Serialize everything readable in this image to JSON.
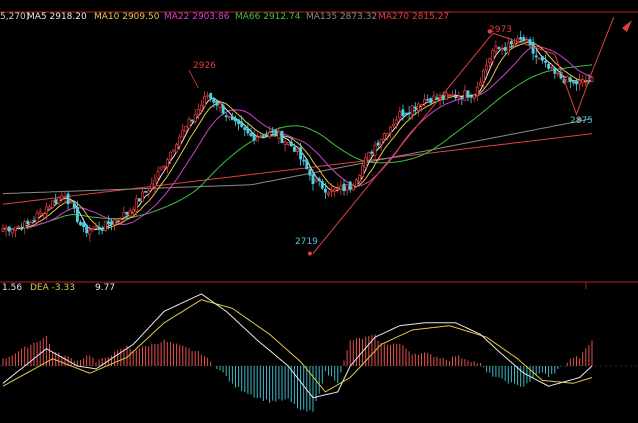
{
  "chart_data": [
    {
      "type": "candlestick",
      "panel": "price",
      "legend": [
        {
          "key": "params",
          "text": "5,270)",
          "color": "#cfcfcf"
        },
        {
          "key": "ma5",
          "text": "MA5 2918.20",
          "color": "#e8e8e8"
        },
        {
          "key": "ma10",
          "text": "MA10 2909.50",
          "color": "#e0c84a"
        },
        {
          "key": "ma22",
          "text": "MA22 2903.86",
          "color": "#d040d0"
        },
        {
          "key": "ma66",
          "text": "MA66 2912.74",
          "color": "#40c040"
        },
        {
          "key": "ma135",
          "text": "MA135 2873.32",
          "color": "#8a8a8a"
        },
        {
          "key": "ma270",
          "text": "MA270 2815.27",
          "color": "#e04040"
        }
      ],
      "annotations": [
        {
          "text": "2926",
          "value": 2926,
          "color": "#e04040"
        },
        {
          "text": "2719",
          "value": 2719,
          "color": "#4fc8d8"
        },
        {
          "text": "2973",
          "value": 2973,
          "color": "#e04040"
        },
        {
          "text": "2875",
          "value": 2875,
          "color": "#4fc8d8"
        }
      ],
      "ylim": [
        2692,
        2996
      ],
      "up_color": "#e83c3c",
      "down_color": "#4fd0e0",
      "close_anchors": [
        [
          0,
          2750
        ],
        [
          8,
          2755
        ],
        [
          14,
          2775
        ],
        [
          20,
          2790
        ],
        [
          26,
          2748
        ],
        [
          32,
          2752
        ],
        [
          40,
          2768
        ],
        [
          48,
          2800
        ],
        [
          56,
          2850
        ],
        [
          62,
          2880
        ],
        [
          66,
          2902
        ],
        [
          70,
          2890
        ],
        [
          74,
          2870
        ],
        [
          80,
          2855
        ],
        [
          88,
          2858
        ],
        [
          94,
          2842
        ],
        [
          100,
          2805
        ],
        [
          106,
          2792
        ],
        [
          112,
          2798
        ],
        [
          120,
          2845
        ],
        [
          128,
          2880
        ],
        [
          136,
          2897
        ],
        [
          144,
          2900
        ],
        [
          152,
          2905
        ],
        [
          158,
          2952
        ],
        [
          164,
          2958
        ],
        [
          168,
          2965
        ],
        [
          172,
          2945
        ],
        [
          178,
          2925
        ],
        [
          184,
          2915
        ],
        [
          190,
          2918
        ]
      ]
    },
    {
      "type": "macd",
      "panel": "indicator",
      "legend": [
        {
          "key": "value1",
          "text": "1.56",
          "color": "#e8e8e8"
        },
        {
          "key": "dea",
          "text": "DEA  -3.33",
          "color": "#e0c84a"
        },
        {
          "key": "value3",
          "text": "9.77",
          "color": "#e8e8e8"
        }
      ],
      "ylim": [
        -36,
        55
      ],
      "pos_color": "#e85050",
      "neg_color": "#40b8c8",
      "dif_anchors": [
        [
          0,
          -12
        ],
        [
          14,
          12
        ],
        [
          24,
          0
        ],
        [
          30,
          -2
        ],
        [
          42,
          15
        ],
        [
          52,
          38
        ],
        [
          64,
          50
        ],
        [
          72,
          38
        ],
        [
          82,
          18
        ],
        [
          92,
          0
        ],
        [
          100,
          -22
        ],
        [
          108,
          -18
        ],
        [
          112,
          0
        ],
        [
          120,
          20
        ],
        [
          128,
          28
        ],
        [
          136,
          30
        ],
        [
          146,
          30
        ],
        [
          154,
          22
        ],
        [
          160,
          10
        ],
        [
          168,
          -5
        ],
        [
          176,
          -14
        ],
        [
          186,
          -8
        ],
        [
          190,
          0
        ]
      ],
      "dea_anchors": [
        [
          0,
          -14
        ],
        [
          16,
          5
        ],
        [
          28,
          -5
        ],
        [
          40,
          6
        ],
        [
          52,
          30
        ],
        [
          64,
          46
        ],
        [
          74,
          40
        ],
        [
          86,
          22
        ],
        [
          96,
          3
        ],
        [
          104,
          -18
        ],
        [
          112,
          -8
        ],
        [
          122,
          15
        ],
        [
          132,
          25
        ],
        [
          144,
          28
        ],
        [
          156,
          20
        ],
        [
          166,
          5
        ],
        [
          174,
          -10
        ],
        [
          184,
          -12
        ],
        [
          190,
          -8
        ]
      ]
    }
  ]
}
